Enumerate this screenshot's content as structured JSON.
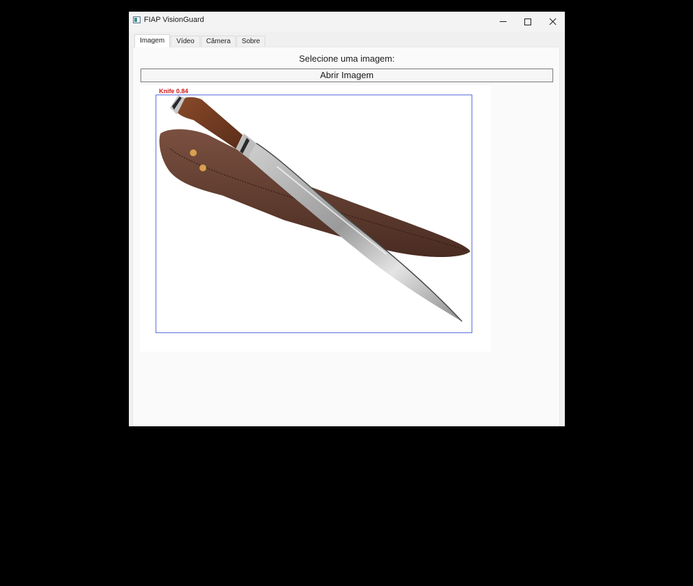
{
  "window": {
    "title": "FIAP VisionGuard",
    "icon": "app-icon"
  },
  "title_buttons": {
    "minimize_icon": "minimize-icon",
    "maximize_icon": "maximize-icon",
    "close_icon": "close-icon"
  },
  "tabs": [
    {
      "label": "Imagem",
      "active": true
    },
    {
      "label": "Vídeo",
      "active": false
    },
    {
      "label": "Câmera",
      "active": false
    },
    {
      "label": "Sobre",
      "active": false
    }
  ],
  "main": {
    "prompt": "Selecione uma imagem:",
    "open_button_label": "Abrir Imagem"
  },
  "detection": {
    "label": "Knife 0.84",
    "class": "Knife",
    "confidence": 0.84,
    "label_color": "#d01818",
    "box_color": "#5a6fe0"
  }
}
